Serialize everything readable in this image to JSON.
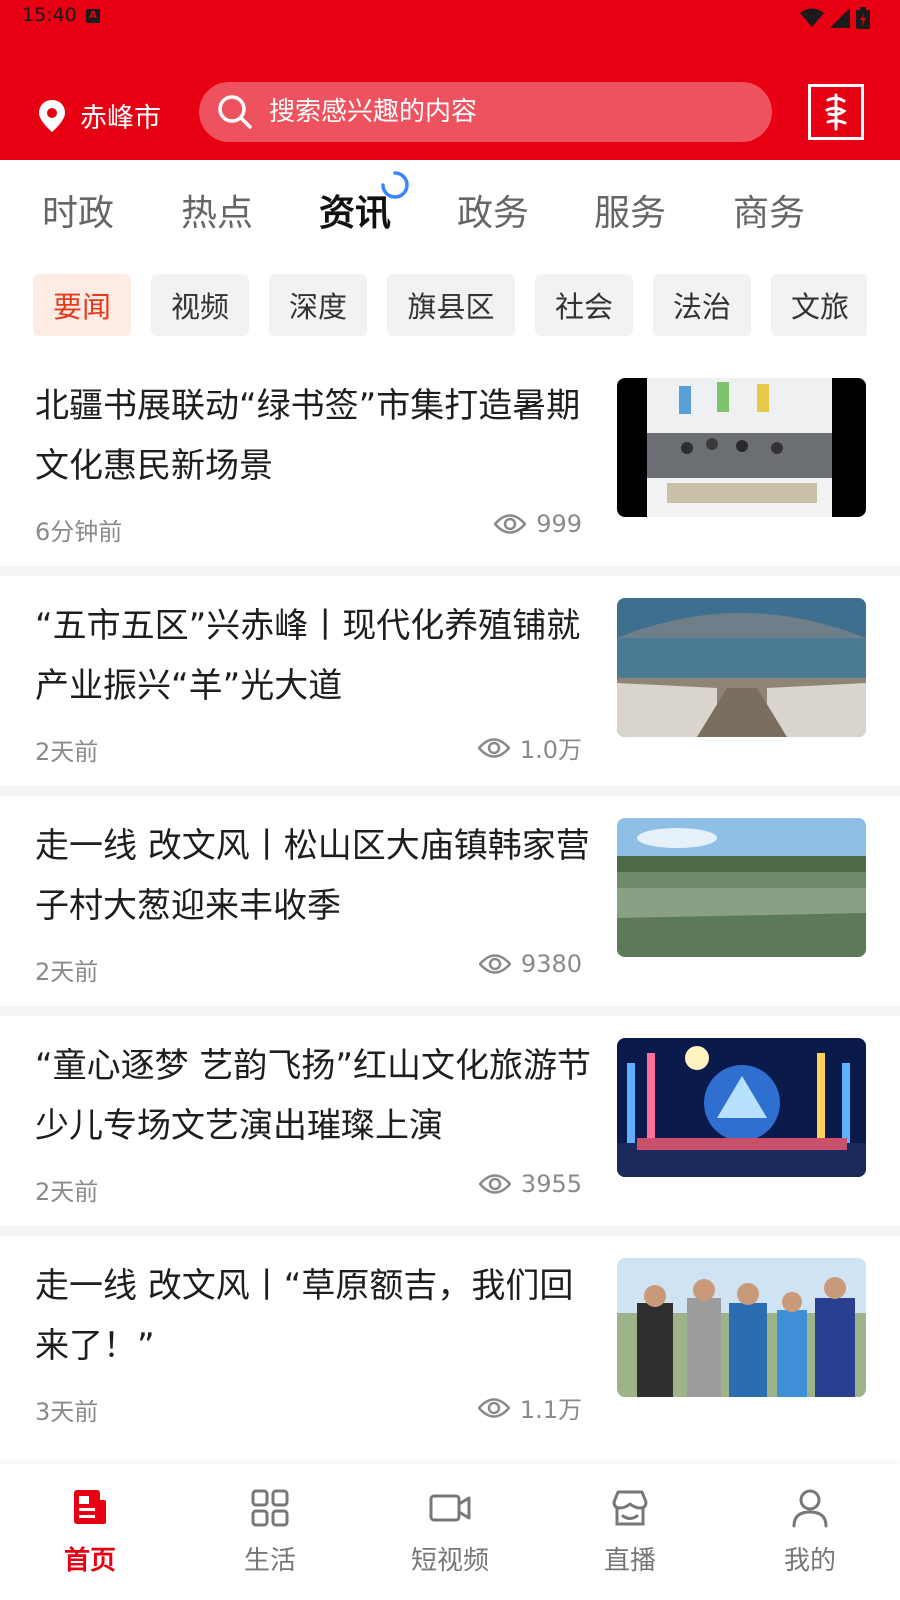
{
  "colors": {
    "brand": "#e60012",
    "chip_active_bg": "#fdece3",
    "chip_active_text": "#e63a1e"
  },
  "status_bar": {
    "time": "15:40"
  },
  "header": {
    "location": "赤峰市",
    "search_placeholder": "搜索感兴趣的内容"
  },
  "channel_tabs": [
    {
      "label": "时政",
      "active": false
    },
    {
      "label": "热点",
      "active": false
    },
    {
      "label": "资讯",
      "active": true
    },
    {
      "label": "政务",
      "active": false
    },
    {
      "label": "服务",
      "active": false
    },
    {
      "label": "商务",
      "active": false
    }
  ],
  "sub_tabs": [
    {
      "label": "要闻",
      "active": true
    },
    {
      "label": "视频",
      "active": false
    },
    {
      "label": "深度",
      "active": false
    },
    {
      "label": "旗县区",
      "active": false
    },
    {
      "label": "社会",
      "active": false
    },
    {
      "label": "法治",
      "active": false
    },
    {
      "label": "文旅",
      "active": false
    }
  ],
  "news": [
    {
      "title": "北疆书展联动“绿书签”市集打造暑期文化惠民新场景",
      "time": "6分钟前",
      "views": "999",
      "image": "book-fair-tent"
    },
    {
      "title": "“五市五区”兴赤峰丨现代化养殖铺就产业振兴“羊”光大道",
      "time": "2天前",
      "views": "1.0万",
      "image": "sheep-barn"
    },
    {
      "title": "走一线 改文风丨松山区大庙镇韩家营子村大葱迎来丰收季",
      "time": "2天前",
      "views": "9380",
      "image": "green-onion-field"
    },
    {
      "title": "“童心逐梦 艺韵飞扬”红山文化旅游节少儿专场文艺演出璀璨上演",
      "time": "2天前",
      "views": "3955",
      "image": "stage-performance"
    },
    {
      "title": "走一线 改文风丨“草原额吉，我们回来了！”",
      "time": "3天前",
      "views": "1.1万",
      "image": "grassland-people"
    }
  ],
  "bottom_nav": [
    {
      "label": "首页",
      "icon": "home-news-icon",
      "active": true
    },
    {
      "label": "生活",
      "icon": "grid-icon",
      "active": false
    },
    {
      "label": "短视频",
      "icon": "video-camera-icon",
      "active": false
    },
    {
      "label": "直播",
      "icon": "storefront-icon",
      "active": false
    },
    {
      "label": "我的",
      "icon": "user-icon",
      "active": false
    }
  ]
}
